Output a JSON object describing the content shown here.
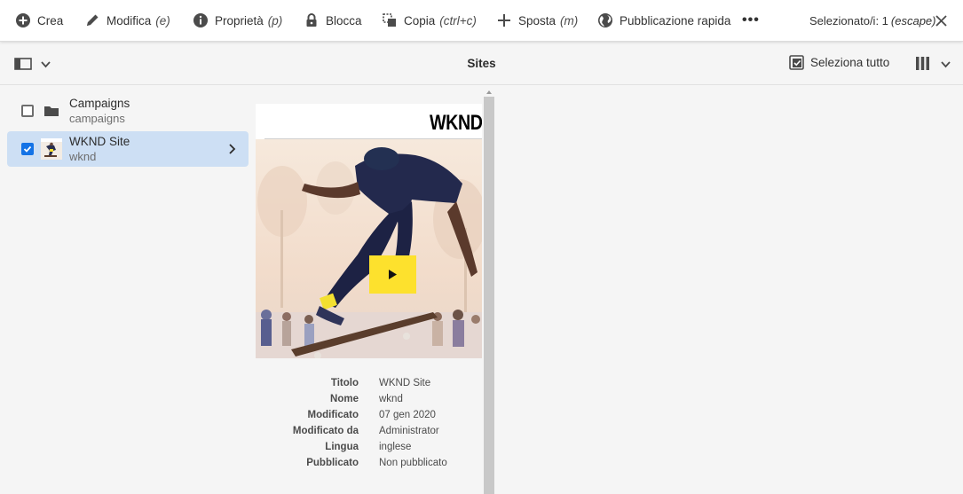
{
  "actionbar": {
    "crea": {
      "label": "Crea",
      "icon": "add-circle-icon"
    },
    "modifica": {
      "label": "Modifica",
      "shortcut": "(e)",
      "icon": "pencil-icon"
    },
    "proprieta": {
      "label": "Proprietà",
      "shortcut": "(p)",
      "icon": "info-icon"
    },
    "blocca": {
      "label": "Blocca",
      "icon": "lock-icon"
    },
    "copia": {
      "label": "Copia",
      "shortcut": "(ctrl+c)",
      "icon": "copy-icon"
    },
    "sposta": {
      "label": "Sposta",
      "shortcut": "(m)",
      "icon": "move-icon"
    },
    "pubblica": {
      "label": "Pubblicazione rapida",
      "icon": "globe-icon"
    },
    "more": {
      "label": "•••",
      "icon": "more-icon"
    },
    "selection": {
      "label": "Selezionato/i: 1",
      "shortcut": "(escape)"
    },
    "close_icon": "close-icon"
  },
  "header": {
    "title": "Sites",
    "select_all": "Seleziona tutto"
  },
  "column1": {
    "items": [
      {
        "title": "Campaigns",
        "name": "campaigns",
        "selected": false,
        "icon": "folder-icon"
      },
      {
        "title": "WKND Site",
        "name": "wknd",
        "selected": true,
        "icon": "site-thumbnail"
      }
    ]
  },
  "preview": {
    "logo_text": "WKND S",
    "metadata": [
      {
        "label": "Titolo",
        "value": "WKND Site"
      },
      {
        "label": "Nome",
        "value": "wknd"
      },
      {
        "label": "Modificato",
        "value": "07 gen 2020"
      },
      {
        "label": "Modificato da",
        "value": "Administrator"
      },
      {
        "label": "Lingua",
        "value": "inglese"
      },
      {
        "label": "Pubblicato",
        "value": "Non pubblicato"
      }
    ]
  },
  "colors": {
    "selected_row": "#cddff4",
    "checkbox_accent": "#1473e6",
    "play_button": "#fde12d"
  }
}
